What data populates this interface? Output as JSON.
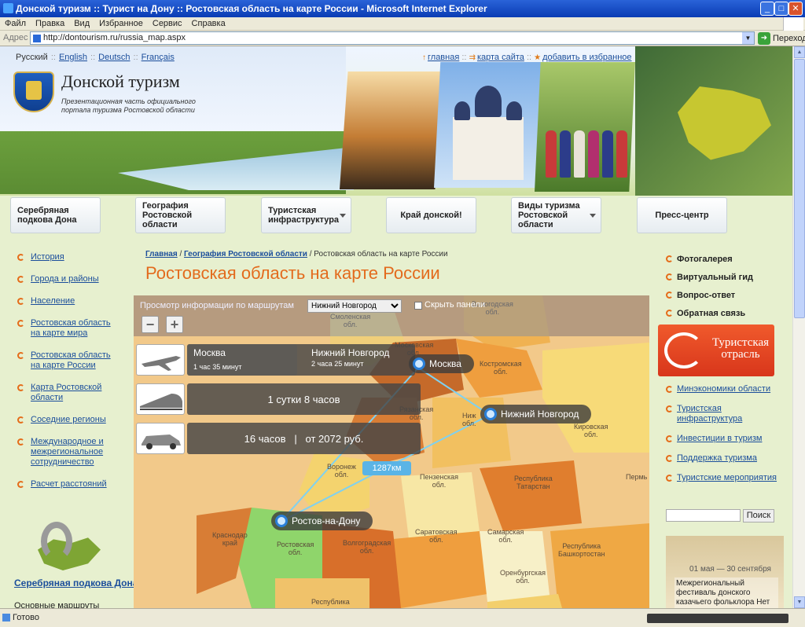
{
  "window": {
    "title": "Донской туризм :: Турист на Дону :: Ростовская область на карте России - Microsoft Internet Explorer"
  },
  "menu": [
    "Файл",
    "Правка",
    "Вид",
    "Избранное",
    "Сервис",
    "Справка"
  ],
  "address": {
    "label": "Адрес",
    "url": "http://dontourism.ru/russia_map.aspx",
    "go": "Переход"
  },
  "status": {
    "text": "Готово"
  },
  "lang": [
    "Русский",
    "English",
    "Deutsch",
    "Français"
  ],
  "toplinks": [
    "главная",
    "карта сайта",
    "добавить в избранное"
  ],
  "brand": {
    "name": "Донской туризм",
    "tagline": "Презентационная часть официального портала туризма Ростовской области"
  },
  "nav": [
    "Серебряная подкова Дона",
    "География Ростовской области",
    "Туристская инфраструктура",
    "Край донской!",
    "Виды туризма Ростовской области",
    "Пресс-центр"
  ],
  "leftnav": [
    "История",
    "Города и районы",
    "Население",
    "Ростовская область на карте мира",
    "Ростовская область на карте России",
    "Карта Ростовской области",
    "Соседние регионы",
    "Международное и межрегиональное сотрудничество",
    "Расчет расстояний"
  ],
  "left_bottom": {
    "title": "Серебряная подкова Дона",
    "sub": "Основные маршруты"
  },
  "breadcrumb": {
    "home": "Главная",
    "geo": "География Ростовской области",
    "current": "Ростовская область на карте России",
    "sep": "/"
  },
  "page_title": "Ростовская область на карте России",
  "map": {
    "routes_label": "Просмотр информации по маршрутам",
    "route_select": "Нижний Новгород",
    "hide_panels": "Скрыть панели",
    "zoom_out": "−",
    "zoom_in": "+",
    "air": {
      "leg1_city": "Москва",
      "leg1_time": "1 час 35 минут",
      "leg2_city": "Нижний Новгород",
      "leg2_time": "2 часа 25 минут"
    },
    "train": "1 сутки 8 часов",
    "car": "16 часов   |   от 2072 руб.",
    "cities": {
      "moscow": "Москва",
      "nn": "Нижний Новгород",
      "rostov": "Ростов-на-Дону"
    },
    "distance": "1287км",
    "regions": {
      "smolensk": "Смоленская\nобл.",
      "vologda": "Вологодская\nобл.",
      "moscow_obl": "Московская\nобл.",
      "kostroma": "Костромская\nобл.",
      "kirov": "Кировская\nобл.",
      "ryazan": "Рязанская\nобл.",
      "voronezh": "Воронеж\nобл.",
      "penza": "Пензенская\nобл.",
      "tatarstan": "Республика\nТатарстан",
      "saratov": "Саратовская\nобл.",
      "samara": "Самарская\nобл.",
      "krasnodar": "Краснодар\nкрай",
      "rostov": "Ростовская\nобл.",
      "volgograd": "Волгоградская\nобл.",
      "bashkortostan": "Республика\nБашкортостан",
      "orenburg": "Оренбургская\nобл.",
      "perm": "Пермь",
      "kalmykia": "Республика",
      "nizhny_reg": "Ниж\nобл."
    }
  },
  "rightnav": [
    "Фотогалерея",
    "Виртуальный гид",
    "Вопрос-ответ",
    "Обратная связь"
  ],
  "tour_banner": "Туристская отрасль",
  "rlinks": [
    "Минэкономики области",
    "Туристская инфраструктура",
    "Инвестиции в туризм",
    "Поддержка туризма",
    "Туристские мероприятия"
  ],
  "search_btn": "Поиск",
  "event": {
    "date": "01 мая — 30 сентября",
    "text": "Межрегиональный фестиваль донского казачьего фольклора Нет"
  },
  "colors": {
    "accent": "#e36b1d",
    "link": "#1b4e9b",
    "title_bar": "#0a3cb4"
  }
}
